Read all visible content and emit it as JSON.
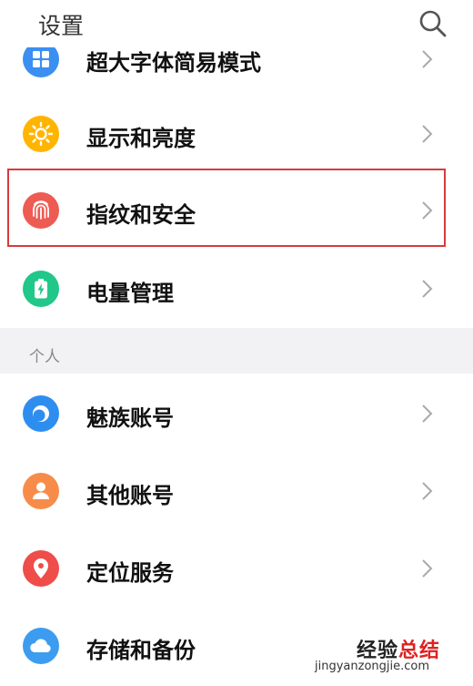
{
  "header": {
    "title": "设置",
    "search_icon": "search-icon"
  },
  "colors": {
    "display_icon": "#ffb400",
    "fingerprint_icon": "#ee5b52",
    "battery_icon": "#22c78a",
    "meizu_account_icon": "#2e8ef0",
    "other_accounts_icon": "#f78c4a",
    "location_icon": "#ee4d4a",
    "storage_icon": "#3c9cf0",
    "highlight_border": "#d93a3a"
  },
  "settings": {
    "items": [
      {
        "label": "超大字体简易模式",
        "icon": "grid-icon"
      },
      {
        "label": "显示和亮度",
        "icon": "sun-icon"
      },
      {
        "label": "指纹和安全",
        "icon": "fingerprint-icon",
        "highlighted": true
      },
      {
        "label": "电量管理",
        "icon": "battery-icon"
      }
    ]
  },
  "personal": {
    "section_title": "个人",
    "items": [
      {
        "label": "魅族账号",
        "icon": "meizu-account-icon"
      },
      {
        "label": "其他账号",
        "icon": "person-icon"
      },
      {
        "label": "定位服务",
        "icon": "location-pin-icon"
      },
      {
        "label": "存储和备份",
        "icon": "cloud-icon"
      }
    ]
  },
  "watermark": {
    "text_a": "经验",
    "text_b": "总结",
    "url": "jingyanzongjie.com"
  }
}
